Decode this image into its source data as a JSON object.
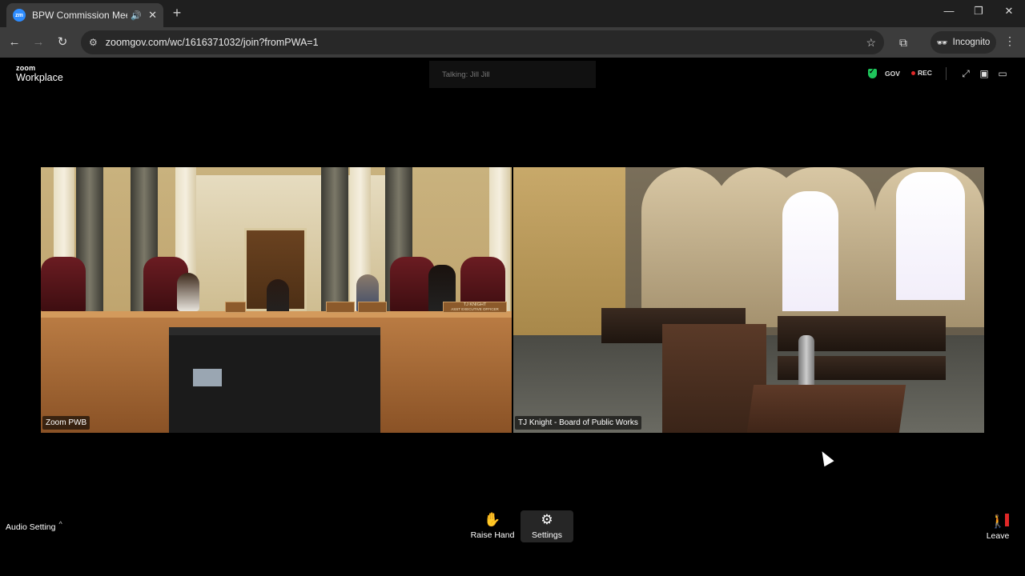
{
  "browser": {
    "tab_title": "BPW Commission Meeting",
    "favicon_text": "zm",
    "url": "zoomgov.com/wc/1616371032/join?fromPWA=1",
    "profile_label": "Incognito"
  },
  "app": {
    "logo_top": "zoom",
    "logo_bottom": "Workplace",
    "talking": "Talking: Jill Jill",
    "gov_label": "GOV",
    "rec_label": "REC",
    "colors": {
      "gov_shield": "#1ec55b",
      "rec_dot": "#e02828",
      "favicon": "#2d8cff"
    }
  },
  "tiles": [
    {
      "name": "Zoom PWB",
      "nameplates": [
        "",
        "",
        "",
        "TJ KNIGHT"
      ],
      "nameplate_sub": "ASST EXECUTIVE OFFICER"
    },
    {
      "name": "TJ Knight - Board of Public Works"
    }
  ],
  "toolbar": {
    "audio_setting": "Audio Setting",
    "raise_hand": "Raise Hand",
    "settings": "Settings",
    "leave": "Leave"
  }
}
